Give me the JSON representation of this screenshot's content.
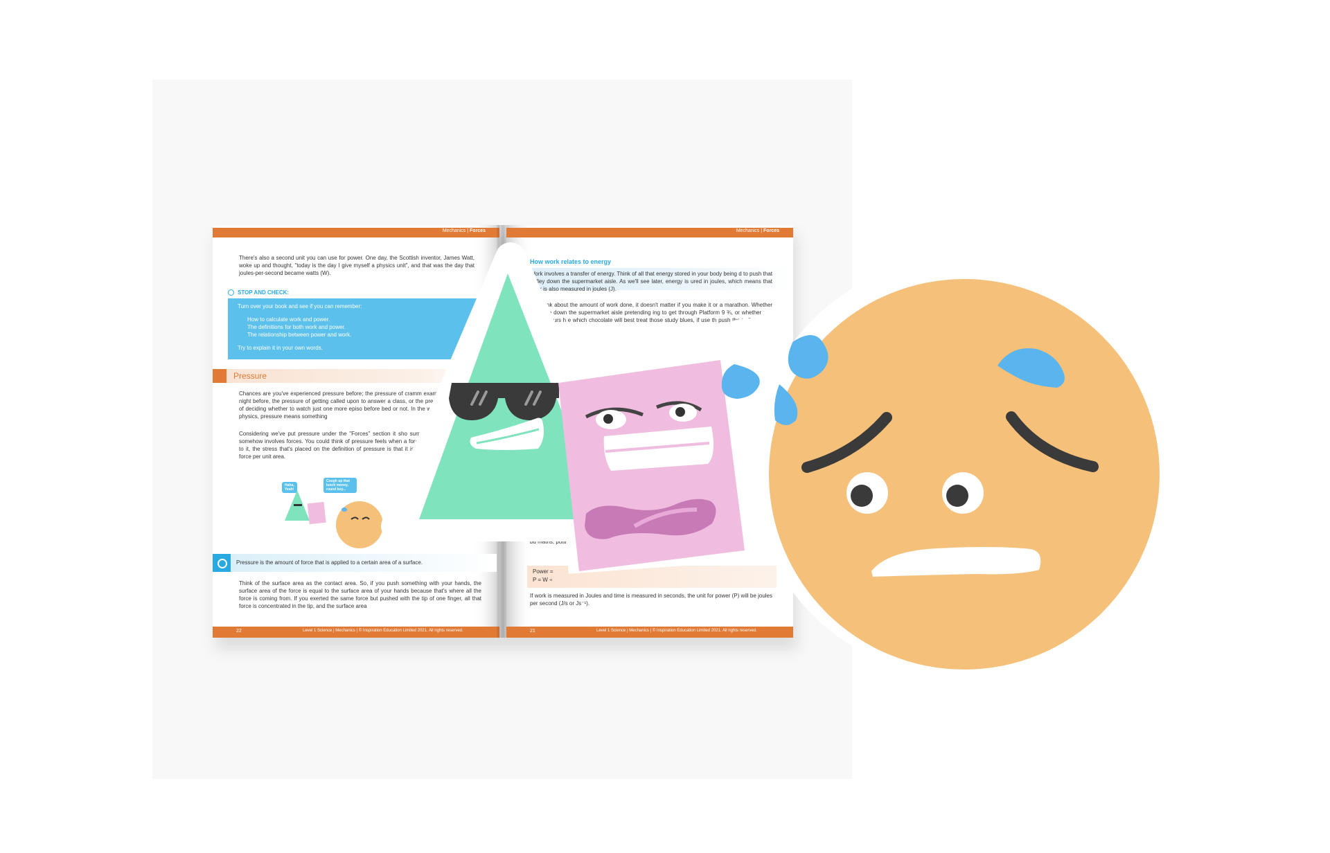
{
  "header": {
    "section": "Mechanics",
    "chapter": "Forces"
  },
  "left_page": {
    "intro": "There's also a second unit you can use for power. One day, the Scottish inventor, James Watt, woke up and thought, \"today is the day I give myself a physics unit\", and that was the day that joules-per-second became watts (W).",
    "stop_check_title": "STOP AND CHECK:",
    "stop_check_prompt": "Turn over your book and see if you can remember:",
    "stop_check_items": [
      "How to calculate work and power.",
      "The definitions for both work and power.",
      "The relationship between power and work."
    ],
    "stop_check_footer": "Try to explain it in your own words.",
    "section_title": "Pressure",
    "paragraph_1": "Chances are you've experienced pressure before; the pressure of cramm exam the night before, the pressure of getting called upon to answer a class, or the pressure of deciding whether to watch just one more episo before bed or not. In the world of physics, pressure means something",
    "paragraph_2": "Considering we've put pressure under the \"Forces\" section it sho surprise that it somehow involves forces. You could think of pressure feels when a force is applied to it, the stress that's placed on the definition of pressure is that it is equal to the force per unit area.",
    "bubble_1": "Haha, Yeah!",
    "bubble_2": "Cough up that lunch money, round boy...",
    "definition": "Pressure is the amount of force that is applied to a certain area of a surface.",
    "paragraph_3": "Think of the surface area as the contact area. So, if you push something with your hands, the surface area of the force is equal to the surface area of your hands because that's where all the force is coming from. If you exerted the same force but pushed with the tip of one finger, all that force is concentrated in the tip, and the surface area",
    "page_number": "22",
    "footer": "Level 1 Science | Mechanics | © Inspiration Education Limited 2021. All rights reserved."
  },
  "right_page": {
    "title": "How work relates to energy",
    "paragraph_1": "Work involves a transfer of energy. Think of all that energy stored in your body being d to push that trolley down the supermarket aisle. As we'll see later, energy is ured in joules, which means that work is also measured in joules (J).",
    "paragraph_2": "you think about the amount of work done, it doesn't matter if you make it or a marathon. Whether you race down the supermarket aisle pretending ing to get through Platform 9 ¾, or whether you take 6 hours h e which chocolate will best treat those study blues, if use th push the trolley and it travels the same distance the day the same.",
    "paragraph_3": "If you inc is an oppo increase, bu maths, putti",
    "formula_1": "Power =",
    "formula_2": "P = W ÷",
    "paragraph_4": "If work is measured in Joules and time is measured in seconds, the unit for power (P) will be joules per second (J/s or Js⁻¹).",
    "page_number": "21",
    "footer": "Level 1 Science | Mechanics | © Inspiration Education Limited 2021. All rights reserved."
  },
  "colors": {
    "orange": "#e07a35",
    "blue": "#29a9e1",
    "light_blue": "#5bc0eb",
    "triangle": "#7fe3bd",
    "square": "#f0bde0",
    "circle": "#f5c07a",
    "tear": "#5ab4ee"
  },
  "icons": [
    "sunglasses-icon",
    "sweat-drop-icon",
    "target-icon",
    "lightbulb-icon"
  ]
}
